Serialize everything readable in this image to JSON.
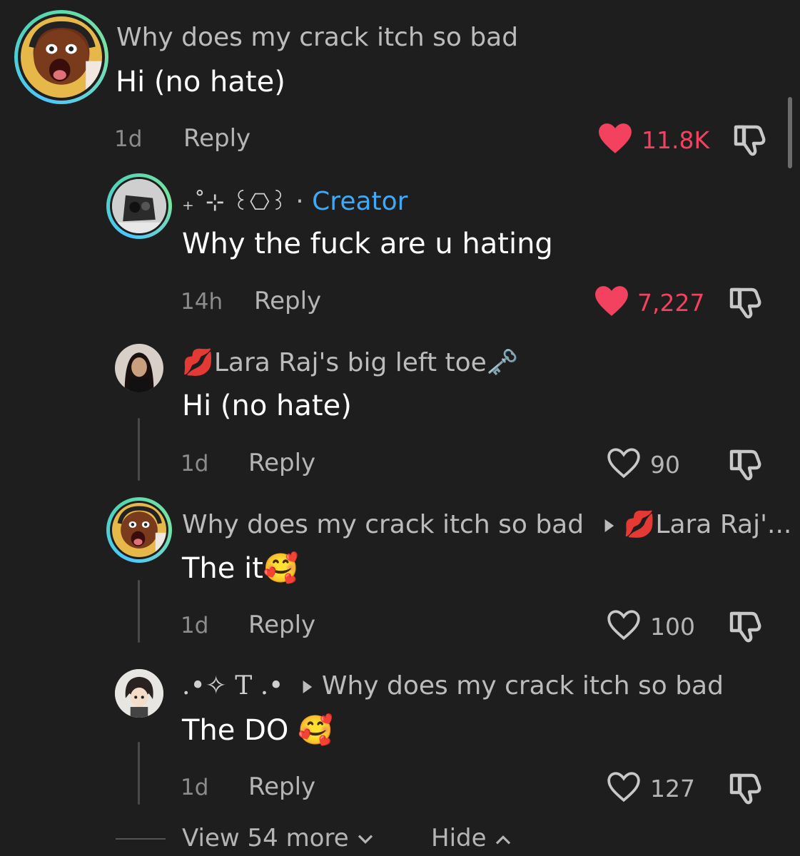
{
  "comments": [
    {
      "username": "Why does my crack itch so bad",
      "text": "Hi (no hate)",
      "time": "1d",
      "reply_label": "Reply",
      "likes": "11.8K",
      "liked": true
    },
    {
      "username": "₊˚⊹ ꒰⎔꒱",
      "separator": "·",
      "creator_label": "Creator",
      "text": "Why the fuck are u hating",
      "time": "14h",
      "reply_label": "Reply",
      "likes": "7,227",
      "liked": true
    },
    {
      "username": "Lara Raj's big left toe",
      "name_prefix_emoji": "💋",
      "name_suffix_emoji": "🗝️",
      "text": "Hi (no hate)",
      "time": "1d",
      "reply_label": "Reply",
      "likes": "90",
      "liked": false
    },
    {
      "username": "Why does my crack itch so bad",
      "reply_to": "Lara Raj'...",
      "reply_to_emoji": "💋",
      "text": "The it",
      "text_emoji": "🥰",
      "time": "1d",
      "reply_label": "Reply",
      "likes": "100",
      "liked": false
    },
    {
      "username": ".•✧ T .•",
      "reply_to": "Why does my crack itch so bad",
      "text": "The DO",
      "text_emoji": "🥰",
      "time": "1d",
      "reply_label": "Reply",
      "likes": "127",
      "liked": false
    }
  ],
  "footer": {
    "view_more": "View 54 more",
    "hide": "Hide"
  },
  "colors": {
    "background": "#1e1e1e",
    "like_red": "#f2425f",
    "creator_blue": "#3fa9f5",
    "story_ring": "#4ec5ff"
  },
  "icons": [
    "heart-filled-icon",
    "heart-outline-icon",
    "thumbs-down-icon",
    "reply-arrow-icon",
    "chevron-down-icon",
    "chevron-up-icon"
  ]
}
